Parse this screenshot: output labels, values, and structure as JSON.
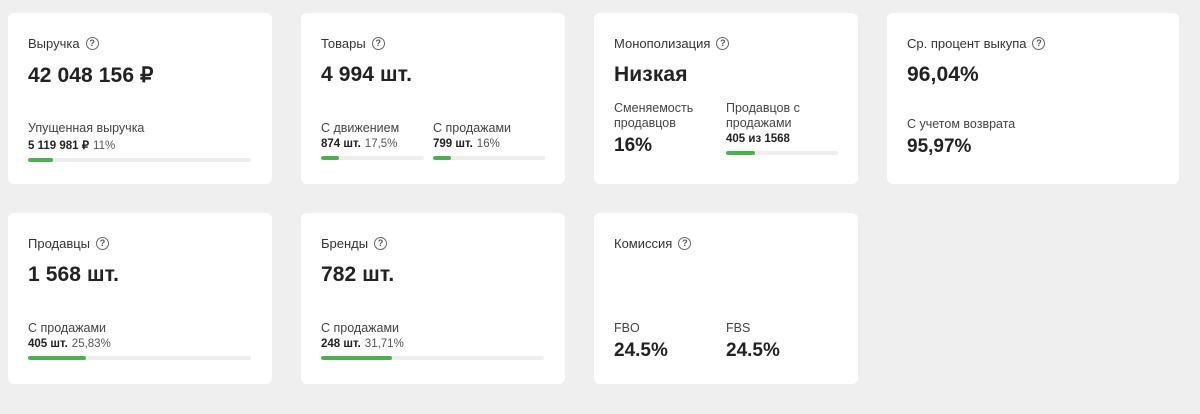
{
  "cards": {
    "revenue": {
      "title": "Выручка",
      "value": "42 048 156 ₽",
      "lost": {
        "label": "Упущенная выручка",
        "value": "5 119 981 ₽",
        "pct": "11%",
        "fill": 0.11
      }
    },
    "products": {
      "title": "Товары",
      "value": "4 994 шт.",
      "with_movement": {
        "label": "С движением",
        "value": "874 шт.",
        "pct": "17,5%",
        "fill": 0.175
      },
      "with_sales": {
        "label": "С продажами",
        "value": "799 шт.",
        "pct": "16%",
        "fill": 0.16
      }
    },
    "monopoly": {
      "title": "Монополизация",
      "value": "Низкая",
      "turnover": {
        "label": "Сменяемость продавцов",
        "value": "16%"
      },
      "sellers_with_sales": {
        "label": "Продавцов с продажами",
        "value": "405 из 1568",
        "fill": 0.258
      }
    },
    "buyout": {
      "title": "Ср. процент выкупа",
      "value": "96,04%",
      "with_returns": {
        "label": "С учетом возврата",
        "value": "95,97%"
      }
    },
    "sellers": {
      "title": "Продавцы",
      "value": "1 568 шт.",
      "with_sales": {
        "label": "С продажами",
        "value": "405 шт.",
        "pct": "25,83%",
        "fill": 0.2583
      }
    },
    "brands": {
      "title": "Бренды",
      "value": "782 шт.",
      "with_sales": {
        "label": "С продажами",
        "value": "248 шт.",
        "pct": "31,71%",
        "fill": 0.3171
      }
    },
    "commission": {
      "title": "Комиссия",
      "fbo": {
        "label": "FBO",
        "value": "24.5%"
      },
      "fbs": {
        "label": "FBS",
        "value": "24.5%"
      }
    }
  }
}
